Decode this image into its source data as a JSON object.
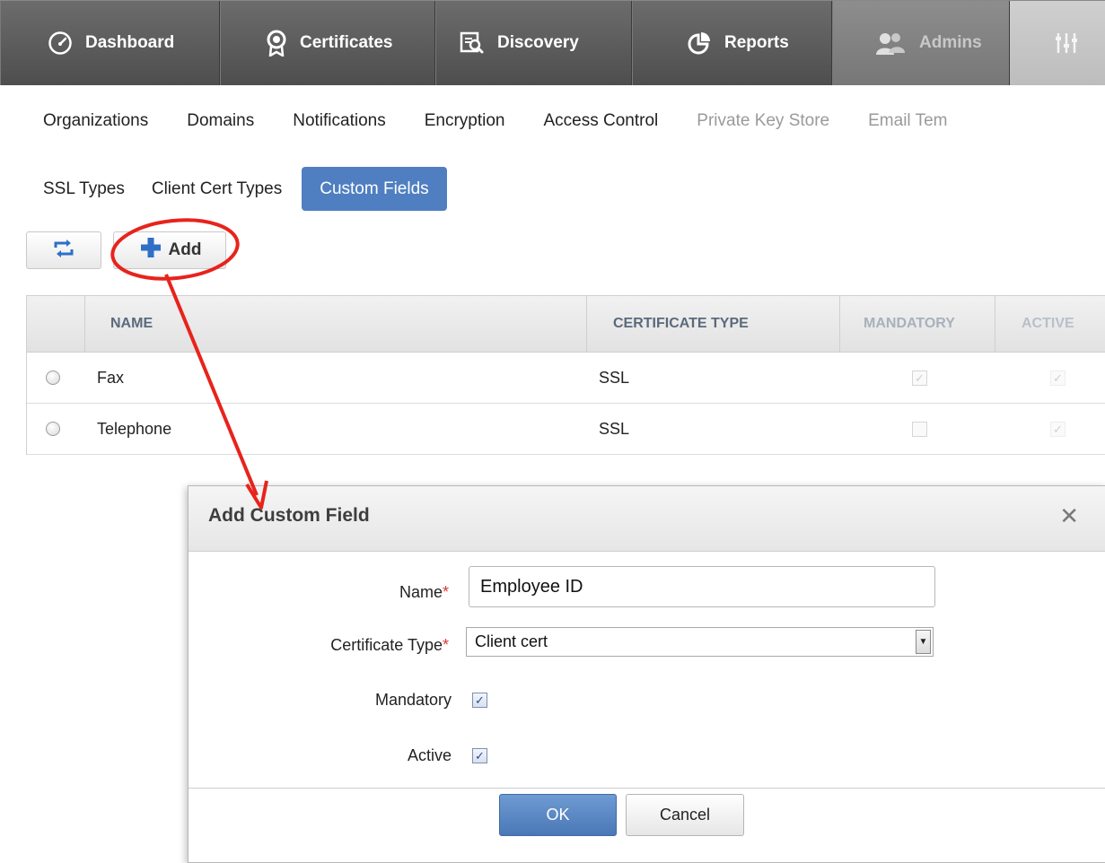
{
  "topnav": {
    "tabs": [
      {
        "label": "Dashboard",
        "icon": "gauge-icon"
      },
      {
        "label": "Certificates",
        "icon": "certificate-icon"
      },
      {
        "label": "Discovery",
        "icon": "discovery-icon"
      },
      {
        "label": "Reports",
        "icon": "pie-chart-icon"
      },
      {
        "label": "Admins",
        "icon": "admins-icon"
      },
      {
        "label": "",
        "icon": "settings-icon"
      }
    ]
  },
  "subnav": {
    "items": [
      "Organizations",
      "Domains",
      "Notifications",
      "Encryption",
      "Access Control",
      "Private Key Store",
      "Email Tem"
    ]
  },
  "subnav2": {
    "items": [
      "SSL Types",
      "Client Cert Types"
    ],
    "active": "Custom Fields"
  },
  "toolbar": {
    "add_label": "Add"
  },
  "table": {
    "columns": [
      "NAME",
      "CERTIFICATE TYPE",
      "MANDATORY",
      "ACTIVE"
    ],
    "rows": [
      {
        "name": "Fax",
        "type": "SSL",
        "mandatory": true,
        "active": true
      },
      {
        "name": "Telephone",
        "type": "SSL",
        "mandatory": false,
        "active": true
      }
    ]
  },
  "modal": {
    "title": "Add Custom Field",
    "close_glyph": "✕",
    "name_label": "Name",
    "name_value": "Employee ID",
    "type_label": "Certificate Type",
    "type_value": "Client cert",
    "mandatory_label": "Mandatory",
    "mandatory_checked": true,
    "active_label": "Active",
    "active_checked": true,
    "required_mark": "*",
    "ok_label": "OK",
    "cancel_label": "Cancel"
  },
  "colors": {
    "accent": "#4f7fc1",
    "annotation": "#e8231c",
    "nav_bg": "#5a5a5a"
  }
}
